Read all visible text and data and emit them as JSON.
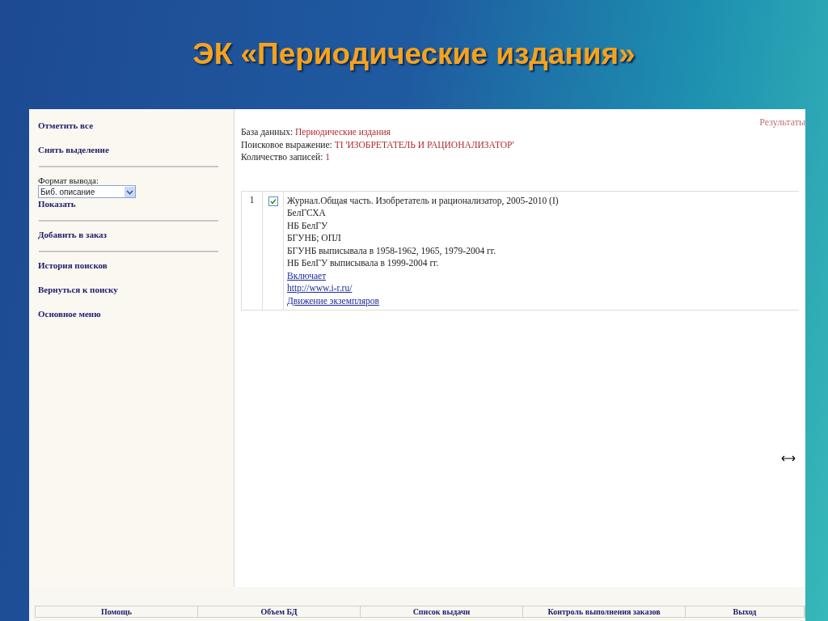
{
  "slide_title": "ЭК «Периодические издания»",
  "sidebar": {
    "items": [
      {
        "kind": "link",
        "label": "Отметить все"
      },
      {
        "kind": "link",
        "label": "Снять выделение"
      },
      {
        "kind": "divider"
      },
      {
        "kind": "select",
        "label": "Формат вывода:",
        "value": "Биб. описание"
      },
      {
        "kind": "link",
        "label": "Показать"
      },
      {
        "kind": "divider"
      },
      {
        "kind": "link",
        "label": "Добавить в заказ"
      },
      {
        "kind": "divider"
      },
      {
        "kind": "link",
        "label": "История поисков"
      },
      {
        "kind": "link",
        "label": "Вернуться к поиску"
      },
      {
        "kind": "link",
        "label": "Основное меню"
      }
    ]
  },
  "results_label": "Результаты",
  "summary": [
    {
      "label": "База данных:",
      "value": "Периодические издания"
    },
    {
      "label": "Поисковое выражение:",
      "value": "TI 'ИЗОБРЕТАТЕЛЬ И РАЦИОНАЛИЗАТОР'"
    },
    {
      "label": "Количество записей:",
      "value": "1"
    }
  ],
  "records": [
    {
      "number": "1",
      "checked": true,
      "lines": [
        "Журнал.Общая часть. Изобретатель и рационализатор, 2005-2010 (I)",
        "БелГСХА",
        "НБ БелГУ",
        "БГУНБ; ОПЛ",
        "БГУНБ выписывала в 1958-1962, 1965, 1979-2004 гг.",
        "НБ БелГУ выписывала в 1999-2004 гг."
      ],
      "links": [
        "Включает",
        "http://www.i-r.ru/",
        "Движение экземпляров"
      ]
    }
  ],
  "footer": [
    "Помощь",
    "Объем БД",
    "Список выдачи",
    "Контроль выполнения заказов",
    "Выход"
  ]
}
